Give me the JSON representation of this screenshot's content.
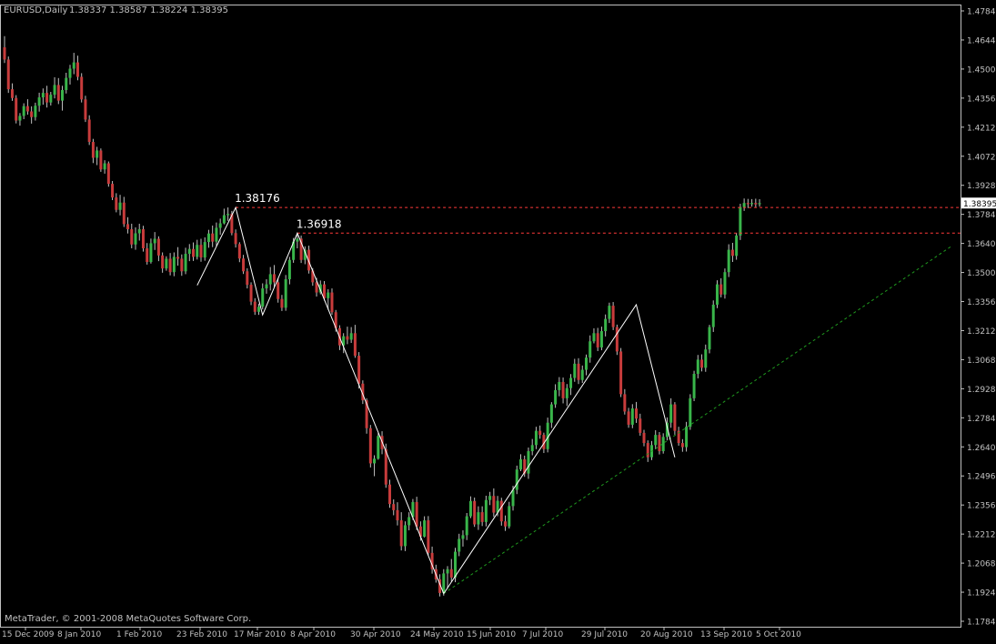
{
  "header": {
    "symbol": "EURUSD,Daily",
    "ohlc": "1.38337 1.38587 1.38224 1.38395"
  },
  "copyright": "MetaTrader, © 2001-2008 MetaQuotes Software Corp.",
  "colors": {
    "background": "#000000",
    "frame": "#c0c0c0",
    "text": "#c0c0c0",
    "candle_up": "#39b54a",
    "candle_down": "#c83c3c",
    "wick": "#c0c0c0",
    "zigzag": "#ffffff",
    "resistance": "#ff3b3b",
    "trendline": "#1f9a1f",
    "price_box_bg": "#ffffff",
    "price_box_text": "#000000"
  },
  "chart_data": {
    "type": "candlestick",
    "title": "EURUSD,Daily",
    "xlabel": "",
    "ylabel": "",
    "ylim": [
      1.1784,
      1.4784
    ],
    "y_ticks": [
      "1.47840",
      "1.46440",
      "1.45000",
      "1.43560",
      "1.42120",
      "1.40720",
      "1.39280",
      "1.37840",
      "1.36400",
      "1.35000",
      "1.33560",
      "1.32120",
      "1.30680",
      "1.29280",
      "1.27840",
      "1.26400",
      "1.24960",
      "1.23560",
      "1.22120",
      "1.20680",
      "1.19240",
      "1.17840"
    ],
    "x_ticks": [
      "15 Dec 2009",
      "8 Jan 2010",
      "1 Feb 2010",
      "23 Feb 2010",
      "17 Mar 2010",
      "8 Apr 2010",
      "30 Apr 2010",
      "24 May 2010",
      "15 Jun 2010",
      "7 Jul 2010",
      "29 Jul 2010",
      "20 Aug 2010",
      "13 Sep 2010",
      "5 Oct 2010"
    ],
    "current_price": "1.38395",
    "current_price_value": 1.38395,
    "annotations": [
      {
        "text": "1.38176",
        "value": 1.38176
      },
      {
        "text": "1.36918",
        "value": 1.36918
      }
    ],
    "resistance_levels": [
      1.38176,
      1.36918
    ],
    "zigzag": [
      {
        "bar": 50,
        "price": 1.3435
      },
      {
        "bar": 60,
        "price": 1.38176
      },
      {
        "bar": 67,
        "price": 1.329
      },
      {
        "bar": 76,
        "price": 1.36918
      },
      {
        "bar": 114,
        "price": 1.192
      },
      {
        "bar": 164,
        "price": 1.334
      },
      {
        "bar": 174,
        "price": 1.259
      }
    ],
    "trendline": [
      {
        "bar": 114,
        "price": 1.192
      },
      {
        "bar": 246,
        "price": 1.363
      }
    ],
    "grid": false,
    "legend": "none",
    "bar_count": 197,
    "candles": [
      [
        1.4605,
        1.466,
        1.4528,
        1.4545
      ],
      [
        1.4545,
        1.456,
        1.4381,
        1.4399
      ],
      [
        1.4399,
        1.4428,
        1.4342,
        1.4356
      ],
      [
        1.4356,
        1.437,
        1.4231,
        1.4245
      ],
      [
        1.4245,
        1.4282,
        1.422,
        1.4268
      ],
      [
        1.4268,
        1.433,
        1.4252,
        1.4316
      ],
      [
        1.4316,
        1.435,
        1.4274,
        1.429
      ],
      [
        1.429,
        1.4315,
        1.423,
        1.4262
      ],
      [
        1.4262,
        1.4333,
        1.4245,
        1.4318
      ],
      [
        1.4318,
        1.4382,
        1.4289,
        1.4359
      ],
      [
        1.4359,
        1.4403,
        1.4323,
        1.4381
      ],
      [
        1.4381,
        1.4416,
        1.4309,
        1.4334
      ],
      [
        1.4334,
        1.4386,
        1.4319,
        1.4372
      ],
      [
        1.4372,
        1.4458,
        1.4354,
        1.442
      ],
      [
        1.442,
        1.4454,
        1.4326,
        1.4343
      ],
      [
        1.4343,
        1.4416,
        1.4294,
        1.4395
      ],
      [
        1.4395,
        1.448,
        1.4378,
        1.4455
      ],
      [
        1.4455,
        1.4519,
        1.4422,
        1.45
      ],
      [
        1.45,
        1.4578,
        1.4473,
        1.4531
      ],
      [
        1.4531,
        1.4564,
        1.4443,
        1.446
      ],
      [
        1.446,
        1.4478,
        1.4334,
        1.4349
      ],
      [
        1.4349,
        1.4367,
        1.4238,
        1.425
      ],
      [
        1.425,
        1.4271,
        1.4125,
        1.414
      ],
      [
        1.414,
        1.4155,
        1.4036,
        1.4062
      ],
      [
        1.4062,
        1.4116,
        1.4026,
        1.4098
      ],
      [
        1.4098,
        1.4108,
        1.3993,
        1.4005
      ],
      [
        1.4005,
        1.405,
        1.3984,
        1.4035
      ],
      [
        1.4035,
        1.4044,
        1.392,
        1.3934
      ],
      [
        1.3934,
        1.3948,
        1.3854,
        1.3867
      ],
      [
        1.3867,
        1.3888,
        1.3794,
        1.3806
      ],
      [
        1.3806,
        1.388,
        1.3779,
        1.3842
      ],
      [
        1.3842,
        1.387,
        1.3722,
        1.3736
      ],
      [
        1.3736,
        1.377,
        1.369,
        1.3711
      ],
      [
        1.3711,
        1.3738,
        1.3617,
        1.3636
      ],
      [
        1.3636,
        1.372,
        1.361,
        1.3691
      ],
      [
        1.3691,
        1.3738,
        1.3655,
        1.3711
      ],
      [
        1.3711,
        1.3728,
        1.3601,
        1.3617
      ],
      [
        1.3617,
        1.3643,
        1.3537,
        1.355
      ],
      [
        1.355,
        1.3665,
        1.3542,
        1.3642
      ],
      [
        1.3642,
        1.3697,
        1.3609,
        1.3664
      ],
      [
        1.3664,
        1.3676,
        1.3554,
        1.3582
      ],
      [
        1.3582,
        1.3597,
        1.3497,
        1.3518
      ],
      [
        1.3518,
        1.3578,
        1.3507,
        1.3566
      ],
      [
        1.3566,
        1.3594,
        1.3484,
        1.35
      ],
      [
        1.35,
        1.3597,
        1.348,
        1.3575
      ],
      [
        1.3575,
        1.3623,
        1.3532,
        1.3566
      ],
      [
        1.3566,
        1.3587,
        1.3482,
        1.3504
      ],
      [
        1.3504,
        1.362,
        1.349,
        1.359
      ],
      [
        1.359,
        1.3638,
        1.3554,
        1.3614
      ],
      [
        1.3614,
        1.3646,
        1.3555,
        1.3575
      ],
      [
        1.3575,
        1.3659,
        1.3562,
        1.3634
      ],
      [
        1.3634,
        1.3664,
        1.3551,
        1.3572
      ],
      [
        1.3572,
        1.3671,
        1.3556,
        1.3648
      ],
      [
        1.3648,
        1.3708,
        1.362,
        1.369
      ],
      [
        1.369,
        1.3729,
        1.3623,
        1.365
      ],
      [
        1.365,
        1.3744,
        1.3628,
        1.3718
      ],
      [
        1.3718,
        1.3763,
        1.3684,
        1.374
      ],
      [
        1.374,
        1.3812,
        1.3735,
        1.378
      ],
      [
        1.378,
        1.3818,
        1.3752,
        1.3786
      ],
      [
        1.3786,
        1.3801,
        1.3681,
        1.3692
      ],
      [
        1.3692,
        1.371,
        1.3621,
        1.3638
      ],
      [
        1.3638,
        1.3647,
        1.3549,
        1.3567
      ],
      [
        1.3567,
        1.3585,
        1.3491,
        1.3504
      ],
      [
        1.3504,
        1.3519,
        1.342,
        1.3438
      ],
      [
        1.3438,
        1.345,
        1.3338,
        1.3355
      ],
      [
        1.3355,
        1.3372,
        1.329,
        1.3305
      ],
      [
        1.3305,
        1.3345,
        1.329,
        1.333
      ],
      [
        1.333,
        1.3445,
        1.3317,
        1.342
      ],
      [
        1.342,
        1.3465,
        1.3394,
        1.344
      ],
      [
        1.344,
        1.3525,
        1.341,
        1.349
      ],
      [
        1.349,
        1.3535,
        1.3424,
        1.345
      ],
      [
        1.345,
        1.347,
        1.335,
        1.3368
      ],
      [
        1.3368,
        1.3388,
        1.3309,
        1.3325
      ],
      [
        1.3325,
        1.3486,
        1.331,
        1.3465
      ],
      [
        1.3465,
        1.3575,
        1.344,
        1.356
      ],
      [
        1.356,
        1.3668,
        1.3546,
        1.365
      ],
      [
        1.365,
        1.3692,
        1.3617,
        1.3665
      ],
      [
        1.3665,
        1.368,
        1.3545,
        1.356
      ],
      [
        1.356,
        1.3627,
        1.3539,
        1.361
      ],
      [
        1.361,
        1.363,
        1.3493,
        1.3508
      ],
      [
        1.3508,
        1.352,
        1.3433,
        1.345
      ],
      [
        1.345,
        1.3472,
        1.338,
        1.34
      ],
      [
        1.34,
        1.3459,
        1.3391,
        1.344
      ],
      [
        1.344,
        1.3456,
        1.336,
        1.3372
      ],
      [
        1.3372,
        1.3416,
        1.3315,
        1.34
      ],
      [
        1.34,
        1.342,
        1.329,
        1.3303
      ],
      [
        1.3303,
        1.3314,
        1.3207,
        1.3225
      ],
      [
        1.3225,
        1.3239,
        1.3117,
        1.314
      ],
      [
        1.314,
        1.32,
        1.3102,
        1.3185
      ],
      [
        1.3185,
        1.3232,
        1.3146,
        1.3168
      ],
      [
        1.3168,
        1.323,
        1.3152,
        1.32
      ],
      [
        1.32,
        1.3241,
        1.3079,
        1.3089
      ],
      [
        1.3089,
        1.3107,
        1.2928,
        1.2952
      ],
      [
        1.2952,
        1.2968,
        1.2852,
        1.287
      ],
      [
        1.287,
        1.288,
        1.2706,
        1.2733
      ],
      [
        1.2733,
        1.2749,
        1.254,
        1.256
      ],
      [
        1.256,
        1.26,
        1.2497,
        1.2583
      ],
      [
        1.2583,
        1.2709,
        1.2578,
        1.2695
      ],
      [
        1.2695,
        1.2718,
        1.2605,
        1.263
      ],
      [
        1.263,
        1.2657,
        1.244,
        1.2456
      ],
      [
        1.2456,
        1.248,
        1.2342,
        1.236
      ],
      [
        1.236,
        1.2383,
        1.2305,
        1.233
      ],
      [
        1.233,
        1.2369,
        1.2255,
        1.228
      ],
      [
        1.228,
        1.232,
        1.2132,
        1.2153
      ],
      [
        1.2153,
        1.2275,
        1.2129,
        1.2256
      ],
      [
        1.2256,
        1.232,
        1.2231,
        1.2296
      ],
      [
        1.2296,
        1.2385,
        1.2282,
        1.237
      ],
      [
        1.237,
        1.2396,
        1.2232,
        1.225
      ],
      [
        1.225,
        1.2275,
        1.218,
        1.22
      ],
      [
        1.22,
        1.23,
        1.2196,
        1.228
      ],
      [
        1.228,
        1.2301,
        1.2108,
        1.212
      ],
      [
        1.212,
        1.2151,
        1.2018,
        1.204
      ],
      [
        1.204,
        1.2062,
        1.1974,
        1.199
      ],
      [
        1.199,
        1.2015,
        1.1906,
        1.1923
      ],
      [
        1.1923,
        1.204,
        1.191,
        1.2019
      ],
      [
        1.2019,
        1.2055,
        1.1944,
        1.204
      ],
      [
        1.204,
        1.209,
        1.1979,
        1.1999
      ],
      [
        1.1999,
        1.2145,
        1.1976,
        1.2126
      ],
      [
        1.2126,
        1.2214,
        1.2104,
        1.2189
      ],
      [
        1.2189,
        1.2231,
        1.2151,
        1.2207
      ],
      [
        1.2207,
        1.2316,
        1.2183,
        1.23
      ],
      [
        1.23,
        1.2398,
        1.2291,
        1.2375
      ],
      [
        1.2375,
        1.2392,
        1.2248,
        1.226
      ],
      [
        1.226,
        1.2349,
        1.2233,
        1.232
      ],
      [
        1.232,
        1.2349,
        1.2252,
        1.2272
      ],
      [
        1.2272,
        1.2401,
        1.225,
        1.238
      ],
      [
        1.238,
        1.242,
        1.2355,
        1.24
      ],
      [
        1.24,
        1.2437,
        1.2297,
        1.2318
      ],
      [
        1.2318,
        1.24,
        1.23,
        1.2376
      ],
      [
        1.2376,
        1.2391,
        1.2254,
        1.2275
      ],
      [
        1.2275,
        1.2304,
        1.2228,
        1.225
      ],
      [
        1.225,
        1.2371,
        1.224,
        1.235
      ],
      [
        1.235,
        1.245,
        1.2328,
        1.243
      ],
      [
        1.243,
        1.2549,
        1.2409,
        1.253
      ],
      [
        1.253,
        1.2605,
        1.2522,
        1.258
      ],
      [
        1.258,
        1.2598,
        1.2494,
        1.251
      ],
      [
        1.251,
        1.2638,
        1.2484,
        1.262
      ],
      [
        1.262,
        1.268,
        1.26,
        1.265
      ],
      [
        1.265,
        1.274,
        1.263,
        1.272
      ],
      [
        1.272,
        1.2746,
        1.2681,
        1.27
      ],
      [
        1.27,
        1.2711,
        1.2611,
        1.263
      ],
      [
        1.263,
        1.2785,
        1.2614,
        1.276
      ],
      [
        1.276,
        1.2861,
        1.2734,
        1.285
      ],
      [
        1.285,
        1.2949,
        1.2833,
        1.292
      ],
      [
        1.292,
        1.2984,
        1.289,
        1.296
      ],
      [
        1.296,
        1.2982,
        1.2855,
        1.288
      ],
      [
        1.288,
        1.295,
        1.2842,
        1.293
      ],
      [
        1.293,
        1.2999,
        1.2896,
        1.298
      ],
      [
        1.298,
        1.3074,
        1.2961,
        1.305
      ],
      [
        1.305,
        1.3077,
        1.295,
        1.297
      ],
      [
        1.297,
        1.3041,
        1.2955,
        1.302
      ],
      [
        1.302,
        1.3095,
        1.2993,
        1.308
      ],
      [
        1.308,
        1.3189,
        1.3055,
        1.316
      ],
      [
        1.316,
        1.3224,
        1.315,
        1.32
      ],
      [
        1.32,
        1.3226,
        1.3112,
        1.313
      ],
      [
        1.313,
        1.3232,
        1.3116,
        1.321
      ],
      [
        1.321,
        1.3292,
        1.3184,
        1.327
      ],
      [
        1.327,
        1.335,
        1.325,
        1.3335
      ],
      [
        1.3335,
        1.3353,
        1.3215,
        1.323
      ],
      [
        1.323,
        1.3242,
        1.3093,
        1.311
      ],
      [
        1.311,
        1.3127,
        1.2886,
        1.29
      ],
      [
        1.29,
        1.2925,
        1.28,
        1.2815
      ],
      [
        1.2815,
        1.2833,
        1.2735,
        1.275
      ],
      [
        1.275,
        1.2851,
        1.2733,
        1.283
      ],
      [
        1.283,
        1.2862,
        1.2759,
        1.278
      ],
      [
        1.278,
        1.2804,
        1.2696,
        1.271
      ],
      [
        1.271,
        1.2725,
        1.2644,
        1.266
      ],
      [
        1.266,
        1.2673,
        1.2567,
        1.259
      ],
      [
        1.259,
        1.267,
        1.2576,
        1.265
      ],
      [
        1.265,
        1.2723,
        1.2629,
        1.27
      ],
      [
        1.27,
        1.2714,
        1.2604,
        1.262
      ],
      [
        1.262,
        1.2708,
        1.2608,
        1.269
      ],
      [
        1.269,
        1.2786,
        1.2673,
        1.276
      ],
      [
        1.276,
        1.288,
        1.2735,
        1.285
      ],
      [
        1.285,
        1.2861,
        1.2701,
        1.272
      ],
      [
        1.272,
        1.274,
        1.2647,
        1.266
      ],
      [
        1.266,
        1.2679,
        1.2617,
        1.264
      ],
      [
        1.264,
        1.2764,
        1.2618,
        1.274
      ],
      [
        1.274,
        1.29,
        1.2725,
        1.288
      ],
      [
        1.288,
        1.3015,
        1.2866,
        1.3
      ],
      [
        1.3,
        1.3093,
        1.2978,
        1.307
      ],
      [
        1.307,
        1.3096,
        1.3012,
        1.303
      ],
      [
        1.303,
        1.3144,
        1.301,
        1.312
      ],
      [
        1.312,
        1.3241,
        1.3101,
        1.323
      ],
      [
        1.323,
        1.3361,
        1.3206,
        1.334
      ],
      [
        1.334,
        1.346,
        1.3323,
        1.344
      ],
      [
        1.344,
        1.347,
        1.3376,
        1.339
      ],
      [
        1.339,
        1.3518,
        1.337,
        1.35
      ],
      [
        1.35,
        1.3637,
        1.3476,
        1.361
      ],
      [
        1.361,
        1.3644,
        1.355,
        1.358
      ],
      [
        1.358,
        1.3693,
        1.3561,
        1.368
      ],
      [
        1.368,
        1.3836,
        1.3658,
        1.382
      ],
      [
        1.382,
        1.3862,
        1.3801,
        1.384
      ],
      [
        1.384,
        1.386,
        1.3815,
        1.3834
      ],
      [
        1.3834,
        1.3859,
        1.3822,
        1.384
      ],
      [
        1.384,
        1.3861,
        1.382,
        1.3833
      ],
      [
        1.38337,
        1.38587,
        1.38224,
        1.38395
      ]
    ]
  }
}
